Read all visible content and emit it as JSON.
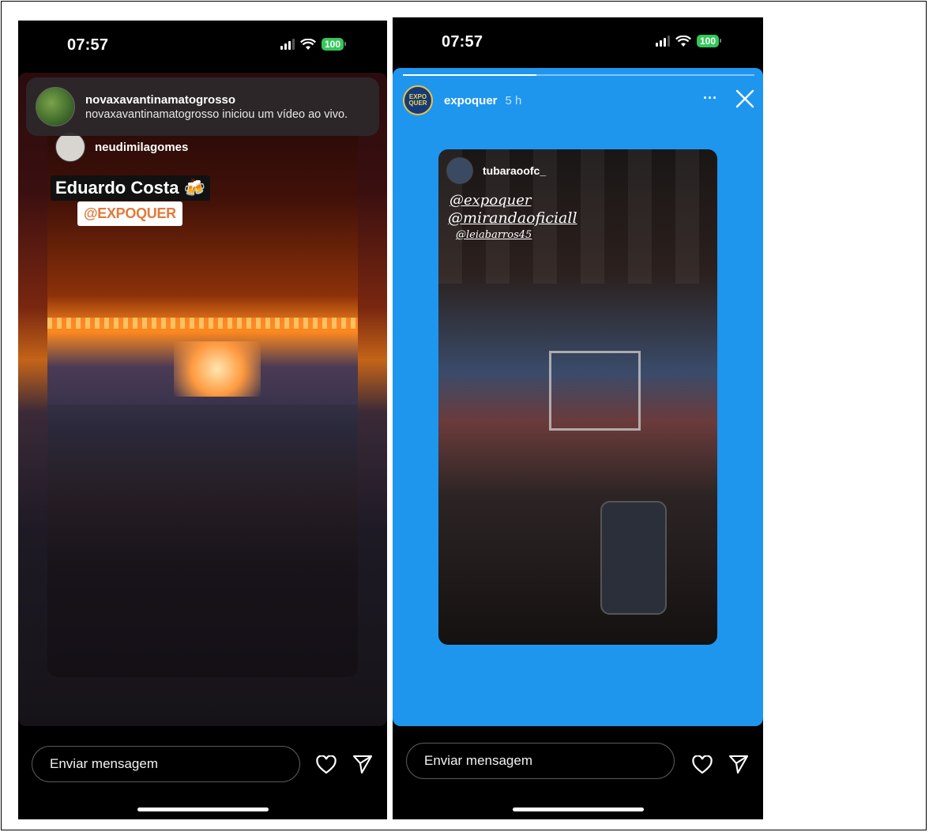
{
  "left_phone": {
    "status": {
      "time": "07:57",
      "battery": "100"
    },
    "notification": {
      "username": "novaxavantinamatogrosso",
      "message": "novaxavantinamatogrosso iniciou um vídeo ao vivo."
    },
    "story": {
      "username": "neudimilagomes",
      "title_sticker": "Eduardo Costa 🍻",
      "mention_sticker": "@EXPOQUER"
    },
    "reply": {
      "placeholder": "Enviar mensagem"
    }
  },
  "right_phone": {
    "status": {
      "time": "07:57",
      "battery": "100"
    },
    "story_header": {
      "username": "expoquer",
      "time_ago": "5 h",
      "avatar_text": "EXPO QUER",
      "more_label": "···"
    },
    "progress": {
      "segments": 1,
      "filled_fraction": 0.38
    },
    "embedded_post": {
      "username": "tubaraoofc_",
      "mentions": [
        "@expoquer",
        "@mirandaoficiall",
        "@leiabarros45"
      ]
    },
    "reply": {
      "placeholder": "Enviar mensagem"
    }
  },
  "colors": {
    "story_background_blue": "#1e96ee",
    "battery_green": "#34c759",
    "mention_orange": "#e07a3a"
  },
  "icons": [
    "signal-icon",
    "wifi-icon",
    "battery-icon",
    "heart-icon",
    "send-icon",
    "more-icon",
    "close-icon"
  ]
}
